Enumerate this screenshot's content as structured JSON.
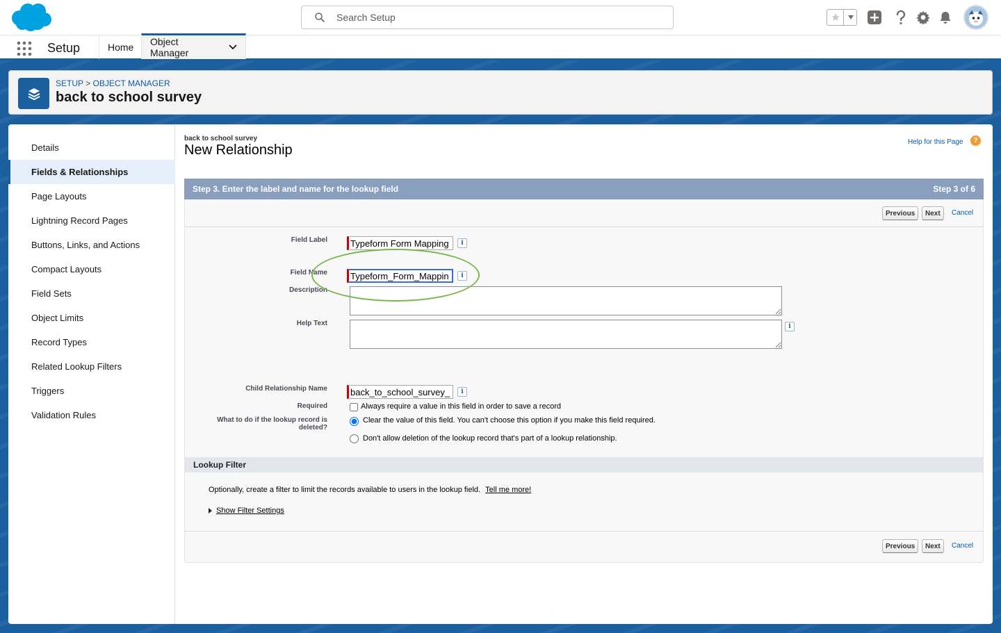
{
  "header": {
    "search_placeholder": "Search Setup"
  },
  "app_nav": {
    "app_name": "Setup",
    "tabs": [
      {
        "label": "Home"
      },
      {
        "label": "Object Manager"
      }
    ]
  },
  "object_header": {
    "breadcrumb_setup": "SETUP",
    "breadcrumb_sep": ">",
    "breadcrumb_object_manager": "OBJECT MANAGER",
    "title": "back to school survey"
  },
  "sidebar": {
    "items": [
      {
        "label": "Details"
      },
      {
        "label": "Fields & Relationships"
      },
      {
        "label": "Page Layouts"
      },
      {
        "label": "Lightning Record Pages"
      },
      {
        "label": "Buttons, Links, and Actions"
      },
      {
        "label": "Compact Layouts"
      },
      {
        "label": "Field Sets"
      },
      {
        "label": "Object Limits"
      },
      {
        "label": "Record Types"
      },
      {
        "label": "Related Lookup Filters"
      },
      {
        "label": "Triggers"
      },
      {
        "label": "Validation Rules"
      }
    ]
  },
  "page": {
    "object_name": "back to school survey",
    "title": "New Relationship",
    "help_link": "Help for this Page",
    "help_icon_text": "?",
    "step_title": "Step 3. Enter the label and name for the lookup field",
    "step_count": "Step 3 of 6"
  },
  "buttons": {
    "previous": "Previous",
    "next": "Next",
    "cancel": "Cancel"
  },
  "form": {
    "field_label_label": "Field Label",
    "field_label_value": "Typeform Form Mapping",
    "field_name_label": "Field Name",
    "field_name_value": "Typeform_Form_Mappin",
    "description_label": "Description",
    "help_text_label": "Help Text",
    "child_rel_label": "Child Relationship Name",
    "child_rel_value": "back_to_school_survey_",
    "required_label": "Required",
    "required_option": "Always require a value in this field in order to save a record",
    "lookup_deleted_label_1": "What to do if the lookup record is",
    "lookup_deleted_label_2": "deleted?",
    "option_clear": "Clear the value of this field. You can't choose this option if you make this field required.",
    "option_dont_allow": "Don't allow deletion of the lookup record that's part of a lookup relationship.",
    "info_glyph": "i"
  },
  "lookup_filter": {
    "heading": "Lookup Filter",
    "description": "Optionally, create a filter to limit the records available to users in the lookup field.",
    "tell_me_more": "Tell me more!",
    "show_filter_settings": "Show Filter Settings"
  },
  "colors": {
    "brand_blue": "#1b5f9e",
    "salesforce_cloud": "#00a1e0",
    "step_bar": "#8a9ebe",
    "required_marker": "#cc0000",
    "annotation_ellipse": "#7ab648"
  },
  "icons": {
    "logo": "salesforce-cloud-logo",
    "search": "search-icon",
    "favorite": "star-icon",
    "add": "plus-icon",
    "help": "question-icon",
    "settings": "gear-icon",
    "notifications": "bell-icon",
    "object": "layers-icon"
  }
}
